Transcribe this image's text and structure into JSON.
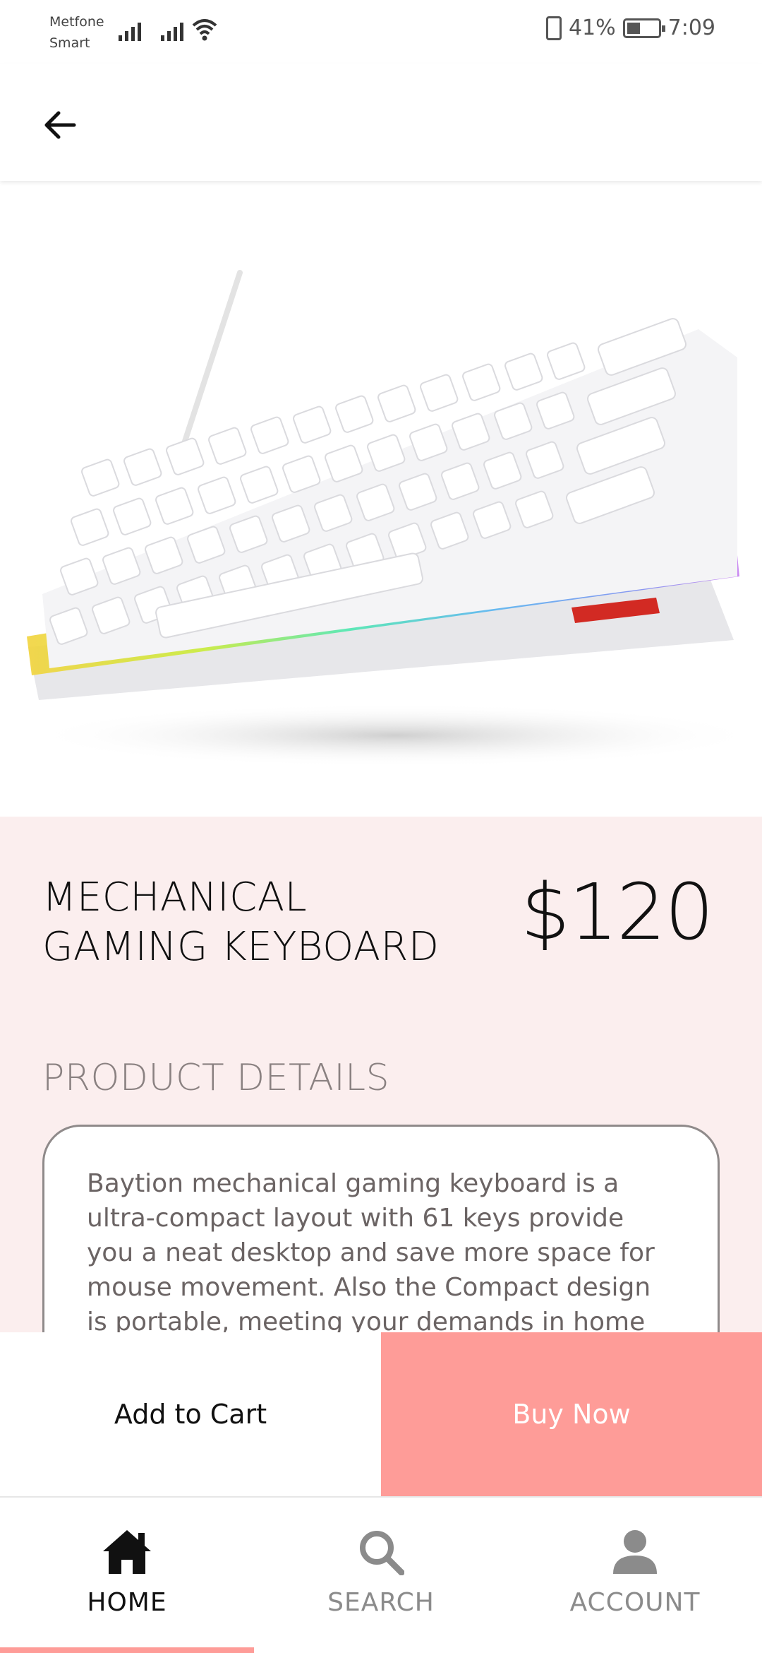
{
  "status_bar": {
    "carrier_line1": "Metfone",
    "carrier_line2": "Smart",
    "battery_percent": "41%",
    "battery_level": 0.41,
    "time": "7:09"
  },
  "header": {
    "back_icon": "arrow-left-icon"
  },
  "product": {
    "image_icon": "keyboard-image",
    "title": "MECHANICAL GAMING KEYBOARD",
    "price": "$120",
    "details_heading": "PRODUCT DETAILS",
    "details_text": "Baytion mechanical gaming keyboard is a ultra-compact layout with 61 keys provide you a neat desktop and save more space for mouse movement. Also the Compact design is portable, meeting your demands in home or office."
  },
  "actions": {
    "add_to_cart": "Add to Cart",
    "buy_now": "Buy Now",
    "buy_now_color": "#fe9c98"
  },
  "nav": {
    "items": [
      {
        "label": "HOME",
        "icon": "home-icon",
        "active": true
      },
      {
        "label": "SEARCH",
        "icon": "search-icon",
        "active": false
      },
      {
        "label": "ACCOUNT",
        "icon": "account-icon",
        "active": false
      }
    ]
  }
}
